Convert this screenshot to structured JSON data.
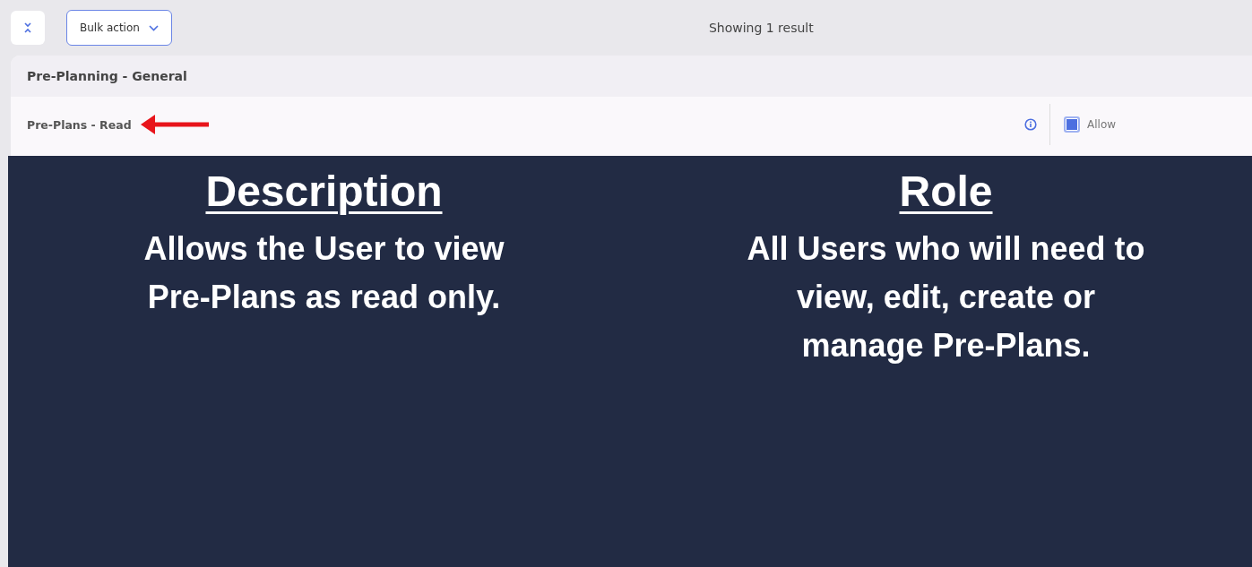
{
  "toolbar": {
    "bulk_action": "Bulk action",
    "result_count": "Showing 1 result"
  },
  "group": {
    "title": "Pre-Planning - General"
  },
  "permissions": [
    {
      "name": "Pre-Plans - Read",
      "allow_label": "Allow",
      "checked": true,
      "highlighted": true
    }
  ],
  "overlay": {
    "columns": [
      {
        "heading": "Description",
        "text": "Allows the User to view Pre-Plans as read only."
      },
      {
        "heading": "Role",
        "text": "All Users who will need to view, edit, create or manage Pre-Plans."
      }
    ]
  }
}
